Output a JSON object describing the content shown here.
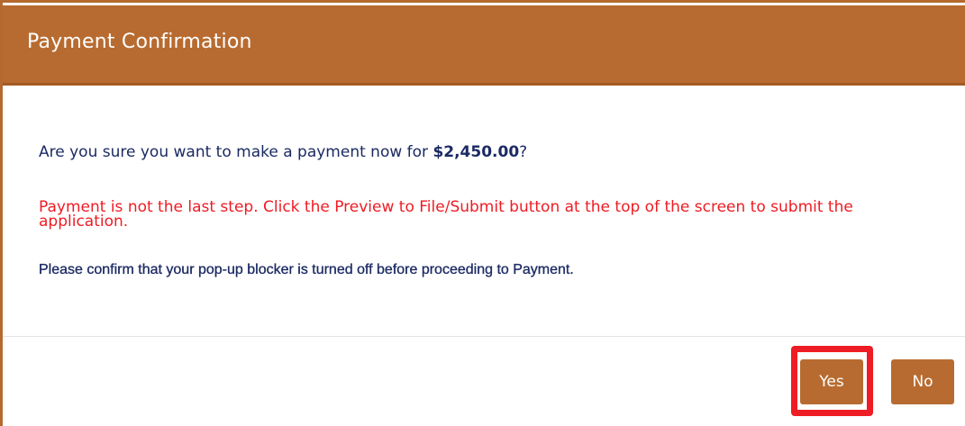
{
  "dialog": {
    "title": "Payment Confirmation",
    "question_prefix": "Are you sure you want to make a payment now for ",
    "amount": "$2,450.00",
    "question_suffix": "?",
    "warning": "Payment is not the last step. Click the Preview to File/Submit button at the top of the screen to submit the application.",
    "popup_note": "Please confirm that your pop-up blocker is turned off before proceeding to Payment."
  },
  "buttons": {
    "yes_label": "Yes",
    "no_label": "No"
  },
  "colors": {
    "header": "#b86b30",
    "button": "#b86b30",
    "warning_text": "#ee1c24",
    "body_text": "#1b2a63",
    "highlight": "#ee1c24"
  }
}
